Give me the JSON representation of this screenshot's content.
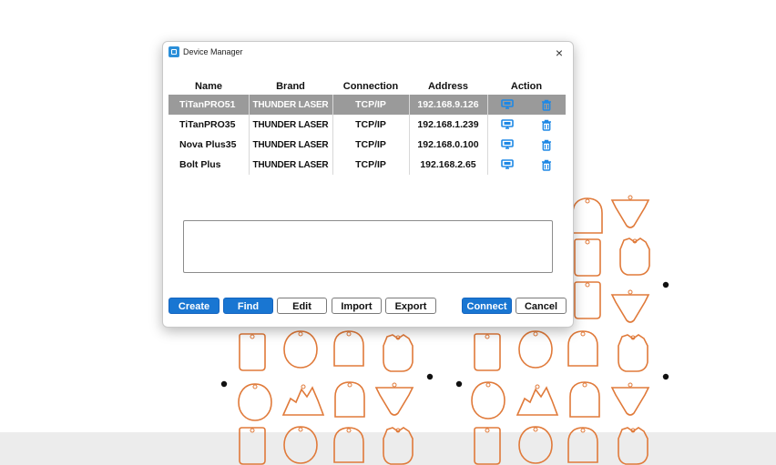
{
  "dialog": {
    "title": "Device Manager",
    "close_glyph": "×",
    "app_icon": "device-manager-app-icon"
  },
  "table": {
    "headers": {
      "name": "Name",
      "brand": "Brand",
      "connection": "Connection",
      "address": "Address",
      "action": "Action"
    },
    "rows": [
      {
        "name": "TiTanPRO51",
        "brand": "THUNDER LASER",
        "connection": "TCP/IP",
        "address": "192.168.9.126",
        "selected": true
      },
      {
        "name": "TiTanPRO35",
        "brand": "THUNDER LASER",
        "connection": "TCP/IP",
        "address": "192.168.1.239",
        "selected": false
      },
      {
        "name": "Nova Plus35",
        "brand": "THUNDER LASER",
        "connection": "TCP/IP",
        "address": "192.168.0.100",
        "selected": false
      },
      {
        "name": "Bolt Plus",
        "brand": "THUNDER LASER",
        "connection": "TCP/IP",
        "address": "192.168.2.65",
        "selected": false
      }
    ],
    "action_icons": [
      "monitor-connect-icon",
      "trash-icon"
    ]
  },
  "log": {
    "value": ""
  },
  "buttons": {
    "create": "Create",
    "find": "Find",
    "edit": "Edit",
    "import": "Import",
    "export": "Export",
    "connect": "Connect",
    "cancel": "Cancel"
  },
  "colors": {
    "accent": "#1976d2",
    "selected_row": "#9a9a9a",
    "shape_outline": "#e07a3a",
    "icon_blue": "#1e88e5"
  }
}
